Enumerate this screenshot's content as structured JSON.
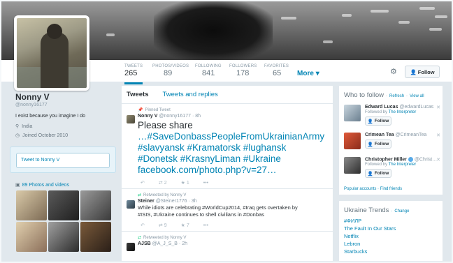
{
  "profile": {
    "name": "Nonny V",
    "handle": "@nonny16177",
    "bio": "I exist because you imagine I do",
    "location": "India",
    "joined": "Joined October 2010"
  },
  "stats": [
    {
      "label": "TWEETS",
      "value": "265"
    },
    {
      "label": "PHOTOS/VIDEOS",
      "value": "89"
    },
    {
      "label": "FOLLOWING",
      "value": "841"
    },
    {
      "label": "FOLLOWERS",
      "value": "178"
    },
    {
      "label": "FAVORITES",
      "value": "65"
    }
  ],
  "nav": {
    "more_label": "More",
    "follow_label": "Follow"
  },
  "tweet_to": {
    "placeholder": "Tweet to Nonny V"
  },
  "photos": {
    "header": "89 Photos and videos"
  },
  "tabs": {
    "tweets": "Tweets",
    "replies": "Tweets and replies"
  },
  "tweets": [
    {
      "context": "Pinned Tweet",
      "author": "Nonny V",
      "handle": "@nonny16177",
      "time": "8h",
      "lines": [
        "Please share",
        "…#SaveDonbassPeopleFromUkrainianArmy",
        "#slavyansk #Kramatorsk #lughansk",
        "#Donetsk #KrasnyLiman #Ukraine",
        "facebook.com/photo.php?v=27…"
      ],
      "retweets": "2",
      "favorites": "1"
    },
    {
      "context": "Retweeted by Nonny V",
      "author": "Steiner",
      "handle": "@Steiner1776",
      "time": "3h",
      "lines": [
        "While idiots are celebrating #WorldCup2014, #Iraq gets overtaken by",
        "#ISIS, #Ukraine continues to shell civilians in #Donbas"
      ],
      "retweets": "9",
      "favorites": "7"
    },
    {
      "context": "Retweeted by Nonny V",
      "author": "AJSB",
      "handle": "@A_J_S_B",
      "time": "2h",
      "lines": [],
      "retweets": "",
      "favorites": ""
    }
  ],
  "who_to_follow": {
    "title": "Who to follow",
    "refresh": "Refresh",
    "view_all": "View all",
    "follow_label": "Follow",
    "suggestions": [
      {
        "name": "Edward Lucas",
        "handle": "@edwardLucas",
        "followed_by_prefix": "Followed by",
        "followed_by": "The Interpreter"
      },
      {
        "name": "Crimean Tea",
        "handle": "@CrimeanTea",
        "followed_by_prefix": "",
        "followed_by": ""
      },
      {
        "name": "Christopher Miller",
        "handle": "@Christ…",
        "followed_by_prefix": "Followed by",
        "followed_by": "The Interpreter"
      }
    ],
    "popular_accounts": "Popular accounts",
    "find_friends": "Find friends"
  },
  "trends": {
    "title": "Ukraine Trends",
    "change": "Change",
    "items": [
      "#ФИЛР",
      "The Fault In Our Stars",
      "Netflix",
      "Lebron",
      "Starbucks"
    ]
  },
  "colors": {
    "link": "#0084b4",
    "accent": "#0084b4",
    "retweet": "#19cf86"
  }
}
